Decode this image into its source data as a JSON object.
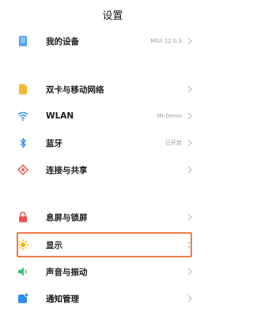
{
  "header": {
    "title": "设置"
  },
  "groups": [
    {
      "items": [
        {
          "label": "我的设备",
          "value": "MIUI 12.0.3",
          "icon": "device-icon"
        }
      ]
    },
    {
      "items": [
        {
          "label": "双卡与移动网络",
          "value": "",
          "icon": "sim-card-icon"
        },
        {
          "label": "WLAN",
          "value": "MI-Demo",
          "icon": "wifi-icon"
        },
        {
          "label": "蓝牙",
          "value": "已开启",
          "icon": "bluetooth-icon"
        },
        {
          "label": "连接与共享",
          "value": "",
          "icon": "connection-sharing-icon"
        }
      ]
    },
    {
      "items": [
        {
          "label": "息屏与锁屏",
          "value": "",
          "icon": "lock-icon"
        },
        {
          "label": "显示",
          "value": "",
          "icon": "brightness-icon",
          "highlighted": true
        },
        {
          "label": "声音与振动",
          "value": "",
          "icon": "speaker-icon"
        },
        {
          "label": "通知管理",
          "value": "",
          "icon": "notification-icon"
        }
      ]
    }
  ],
  "colors": {
    "highlight_border": "#f07d44",
    "device": "#4b9cf5",
    "sim": "#f6b731",
    "wifi": "#2f8cf4",
    "bluetooth": "#2f8cf4",
    "share": "#f05a4f",
    "lock": "#ef4f4f",
    "brightness": "#f5b400",
    "sound": "#35c46b",
    "notification": "#2f8cf4"
  }
}
